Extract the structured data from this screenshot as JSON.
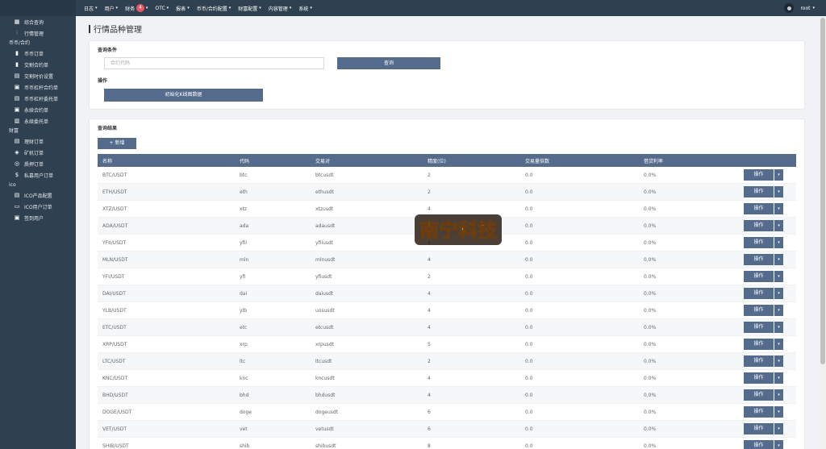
{
  "sidebar": {
    "items": [
      {
        "type": "item",
        "icon": "grid-icon",
        "glyph": "▦",
        "label": "综合查询"
      },
      {
        "type": "item",
        "icon": "chart-icon",
        "glyph": "⫶",
        "label": "行情管理"
      },
      {
        "type": "group",
        "label": "币币/合约"
      },
      {
        "type": "item",
        "icon": "bookmark-icon",
        "glyph": "▮",
        "label": "币币订单"
      },
      {
        "type": "item",
        "icon": "bookmark-icon",
        "glyph": "▮",
        "label": "交割合约单"
      },
      {
        "type": "item",
        "icon": "file-icon",
        "glyph": "▤",
        "label": "交割时价设置"
      },
      {
        "type": "item",
        "icon": "copy-icon",
        "glyph": "▣",
        "label": "币币杠杆合约单"
      },
      {
        "type": "item",
        "icon": "list-icon",
        "glyph": "▤",
        "label": "币币杠杆委托单"
      },
      {
        "type": "item",
        "icon": "copy-icon",
        "glyph": "▣",
        "label": "永续合约单"
      },
      {
        "type": "item",
        "icon": "book-icon",
        "glyph": "▥",
        "label": "永续委托单"
      },
      {
        "type": "group",
        "label": "财富"
      },
      {
        "type": "item",
        "icon": "stack-icon",
        "glyph": "▤",
        "label": "理财订单"
      },
      {
        "type": "item",
        "icon": "cube-icon",
        "glyph": "◈",
        "label": "矿机订单"
      },
      {
        "type": "item",
        "icon": "database-icon",
        "glyph": "◎",
        "label": "质押订单"
      },
      {
        "type": "item",
        "icon": "dollar-icon",
        "glyph": "$",
        "label": "私募用户订单"
      },
      {
        "type": "group",
        "label": "ico"
      },
      {
        "type": "item",
        "icon": "doc-icon",
        "glyph": "▤",
        "label": "ICO产品配置"
      },
      {
        "type": "item",
        "icon": "monitor-icon",
        "glyph": "▭",
        "label": "ICO用户订单"
      },
      {
        "type": "item",
        "icon": "id-card-icon",
        "glyph": "▣",
        "label": "签到用户"
      }
    ]
  },
  "topnav": {
    "items": [
      {
        "label": "日志",
        "caret": "▾"
      },
      {
        "label": "用户",
        "caret": "▾"
      },
      {
        "label": "财务",
        "badge": "4",
        "caret": "▾"
      },
      {
        "label": "OTC",
        "caret": "▾"
      },
      {
        "label": "报表",
        "caret": "▾"
      },
      {
        "label": "币币/合约配置",
        "caret": "▾"
      },
      {
        "label": "财富配置",
        "caret": "▾"
      },
      {
        "label": "内容管理",
        "caret": "▾"
      },
      {
        "label": "系统",
        "caret": "▾"
      }
    ],
    "user": "root",
    "user_caret": "▾"
  },
  "page": {
    "title": "行情品种管理",
    "query_section_label": "查询条件",
    "search_placeholder": "合约代码",
    "query_button": "查询",
    "operation_label": "操作",
    "init_button": "初始化K线图数据",
    "results_label": "查询结果",
    "add_button": "+ 新增"
  },
  "table": {
    "columns": [
      "名称",
      "代码",
      "交易对",
      "精度(位)",
      "交易量倍数",
      "借贷利率",
      ""
    ],
    "action_label": "操作",
    "action_caret": "▾",
    "rows": [
      [
        "BTC/USDT",
        "btc",
        "btcusdt",
        "2",
        "0.0",
        "0.0%"
      ],
      [
        "ETH/USDT",
        "eth",
        "ethusdt",
        "2",
        "0.0",
        "0.0%"
      ],
      [
        "XTZ/USDT",
        "xtz",
        "xtzusdt",
        "4",
        "0.0",
        "0.0%"
      ],
      [
        "ADA/USDT",
        "ada",
        "adausdt",
        "6",
        "0.0",
        "0.0%"
      ],
      [
        "YFII/USDT",
        "yfii",
        "yfiiusdt",
        "4",
        "0.0",
        "0.0%"
      ],
      [
        "MLN/USDT",
        "mln",
        "mlnusdt",
        "4",
        "0.0",
        "0.0%"
      ],
      [
        "YFI/USDT",
        "yfi",
        "yfiusdt",
        "2",
        "0.0",
        "0.0%"
      ],
      [
        "DAI/USDT",
        "dai",
        "daiusdt",
        "4",
        "0.0",
        "0.0%"
      ],
      [
        "YLB/USDT",
        "ylb",
        "uosusdt",
        "4",
        "0.0",
        "0.0%"
      ],
      [
        "ETC/USDT",
        "etc",
        "etcusdt",
        "4",
        "0.0",
        "0.0%"
      ],
      [
        "XRP/USDT",
        "xrp",
        "xrpusdt",
        "5",
        "0.0",
        "0.0%"
      ],
      [
        "LTC/USDT",
        "ltc",
        "ltcusdt",
        "2",
        "0.0",
        "0.0%"
      ],
      [
        "KNC/USDT",
        "knc",
        "kncusdt",
        "4",
        "0.0",
        "0.0%"
      ],
      [
        "BHD/USDT",
        "bhd",
        "bhdusdt",
        "4",
        "0.0",
        "0.0%"
      ],
      [
        "DOGE/USDT",
        "doge",
        "dogeusdt",
        "6",
        "0.0",
        "0.0%"
      ],
      [
        "VET/USDT",
        "vet",
        "vetusdt",
        "6",
        "0.0",
        "0.0%"
      ],
      [
        "SHIB/USDT",
        "shib",
        "shibusdt",
        "8",
        "0.0",
        "0.0%"
      ]
    ]
  },
  "watermark": {
    "text": "南宁科技"
  },
  "colors": {
    "sidebar_bg": "#2f4050",
    "primary_button": "#556b8b",
    "badge": "#ed5565"
  }
}
